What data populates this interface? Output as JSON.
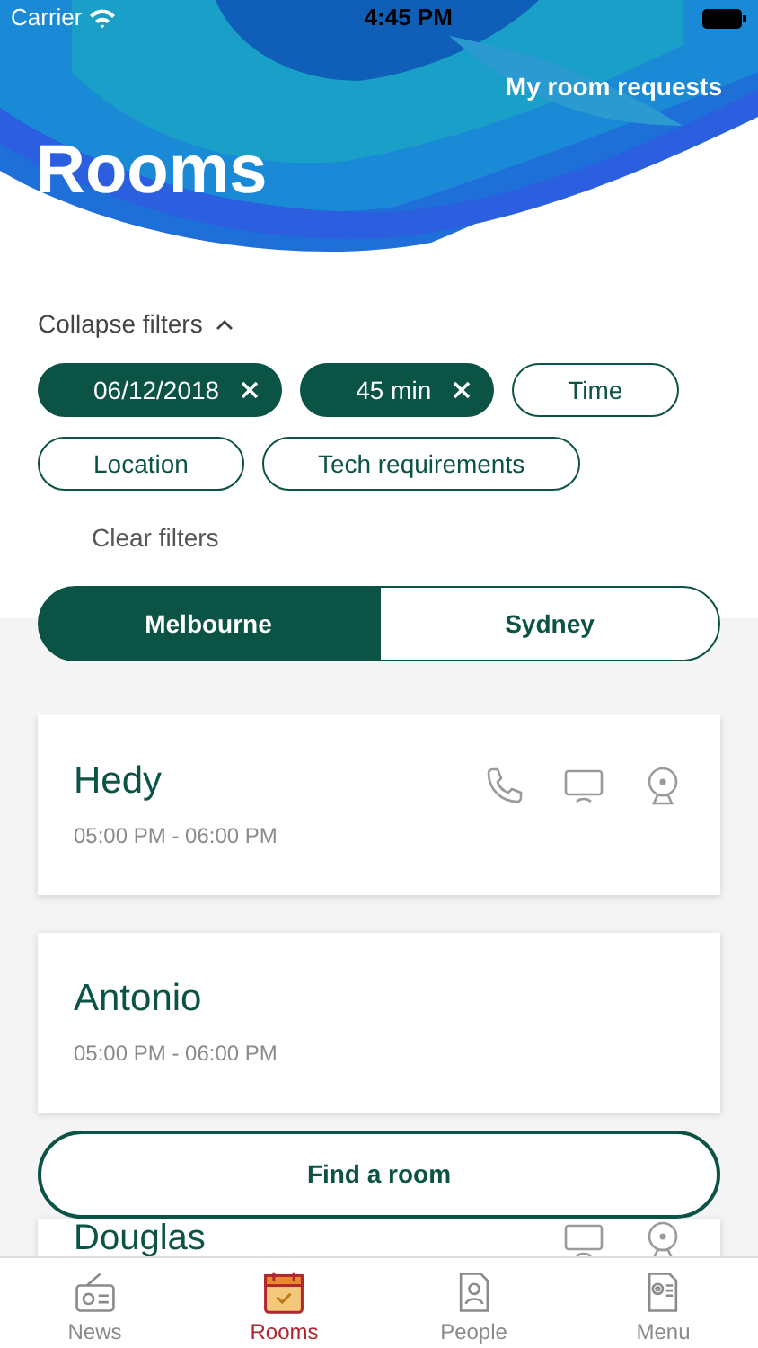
{
  "status_bar": {
    "carrier": "Carrier",
    "time": "4:45 PM"
  },
  "header": {
    "link": "My room requests",
    "title": "Rooms",
    "kind": "picture"
  },
  "filters": {
    "toggle": "Collapse filters",
    "expanded": true,
    "chips": [
      {
        "label": "06/12/2018",
        "selected": true
      },
      {
        "label": "45 min",
        "selected": true
      },
      {
        "label": "Time",
        "selected": false
      },
      {
        "label": "Location",
        "selected": false
      },
      {
        "label": "Tech requirements",
        "selected": false
      }
    ],
    "clear": "Clear filters"
  },
  "locations": [
    {
      "label": "Melbourne",
      "selected": true
    },
    {
      "label": "Sydney",
      "selected": false
    }
  ],
  "rooms": [
    {
      "name": "Hedy",
      "time": "05:00 PM - 06:00 PM",
      "amenities": [
        {
          "kind": "phone"
        },
        {
          "kind": "screen"
        },
        {
          "kind": "webcam"
        }
      ]
    },
    {
      "name": "Antonio",
      "time": "05:00 PM - 06:00 PM"
    },
    {
      "name": "Douglas",
      "amenities": [
        {
          "kind": "screen"
        },
        {
          "kind": "webcam"
        }
      ]
    }
  ],
  "find_button": "Find a room",
  "tab_bar": [
    {
      "label": "News",
      "selected": false
    },
    {
      "label": "Rooms",
      "selected": true
    },
    {
      "label": "People",
      "selected": false
    },
    {
      "label": "Menu",
      "selected": false
    }
  ]
}
